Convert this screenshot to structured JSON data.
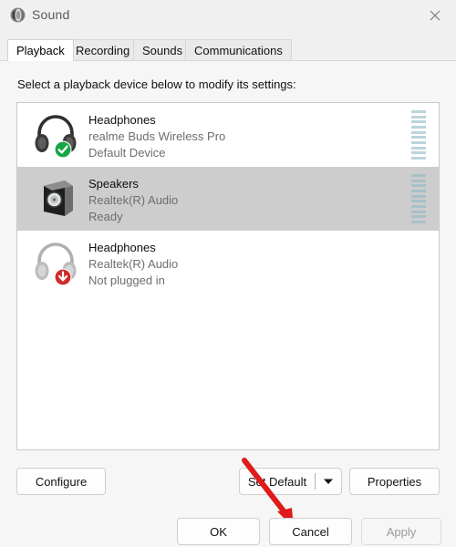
{
  "window": {
    "title": "Sound",
    "icon": "speaker-icon",
    "close_label": "✕"
  },
  "tabs": [
    {
      "label": "Playback",
      "active": true
    },
    {
      "label": "Recording",
      "active": false
    },
    {
      "label": "Sounds",
      "active": false
    },
    {
      "label": "Communications",
      "active": false
    }
  ],
  "main": {
    "instruction": "Select a playback device below to modify its settings:",
    "devices": [
      {
        "name": "Headphones",
        "driver": "realme Buds Wireless Pro",
        "status": "Default Device",
        "icon": "headphones-icon",
        "badge": "check-badge",
        "selected": false,
        "meter_segments": 10,
        "meter_level": 10
      },
      {
        "name": "Speakers",
        "driver": "Realtek(R) Audio",
        "status": "Ready",
        "icon": "speaker-box-icon",
        "badge": "none",
        "selected": true,
        "meter_segments": 10,
        "meter_level": 10
      },
      {
        "name": "Headphones",
        "driver": "Realtek(R) Audio",
        "status": "Not plugged in",
        "icon": "headphones-gray-icon",
        "badge": "down-arrow-badge",
        "selected": false,
        "meter_segments": 0,
        "meter_level": 0
      }
    ]
  },
  "actions": {
    "configure": "Configure",
    "set_default": "Set Default",
    "set_default_dropdown": "▼",
    "properties": "Properties"
  },
  "footer": {
    "ok": "OK",
    "cancel": "Cancel",
    "apply": "Apply",
    "apply_disabled": true
  },
  "annotation": {
    "type": "red-arrow",
    "color": "#e01b1b",
    "points_to": "Set Default"
  },
  "colors": {
    "window_bg": "#f0f0f0",
    "panel_bg": "#f6f6f6",
    "list_bg": "#ffffff",
    "selection_bg": "#cdcdcd",
    "meter_fill": "#bcd4dd",
    "default_badge": "#1aad4b",
    "unplugged_badge": "#d32f2f",
    "annotation": "#e01b1b"
  }
}
